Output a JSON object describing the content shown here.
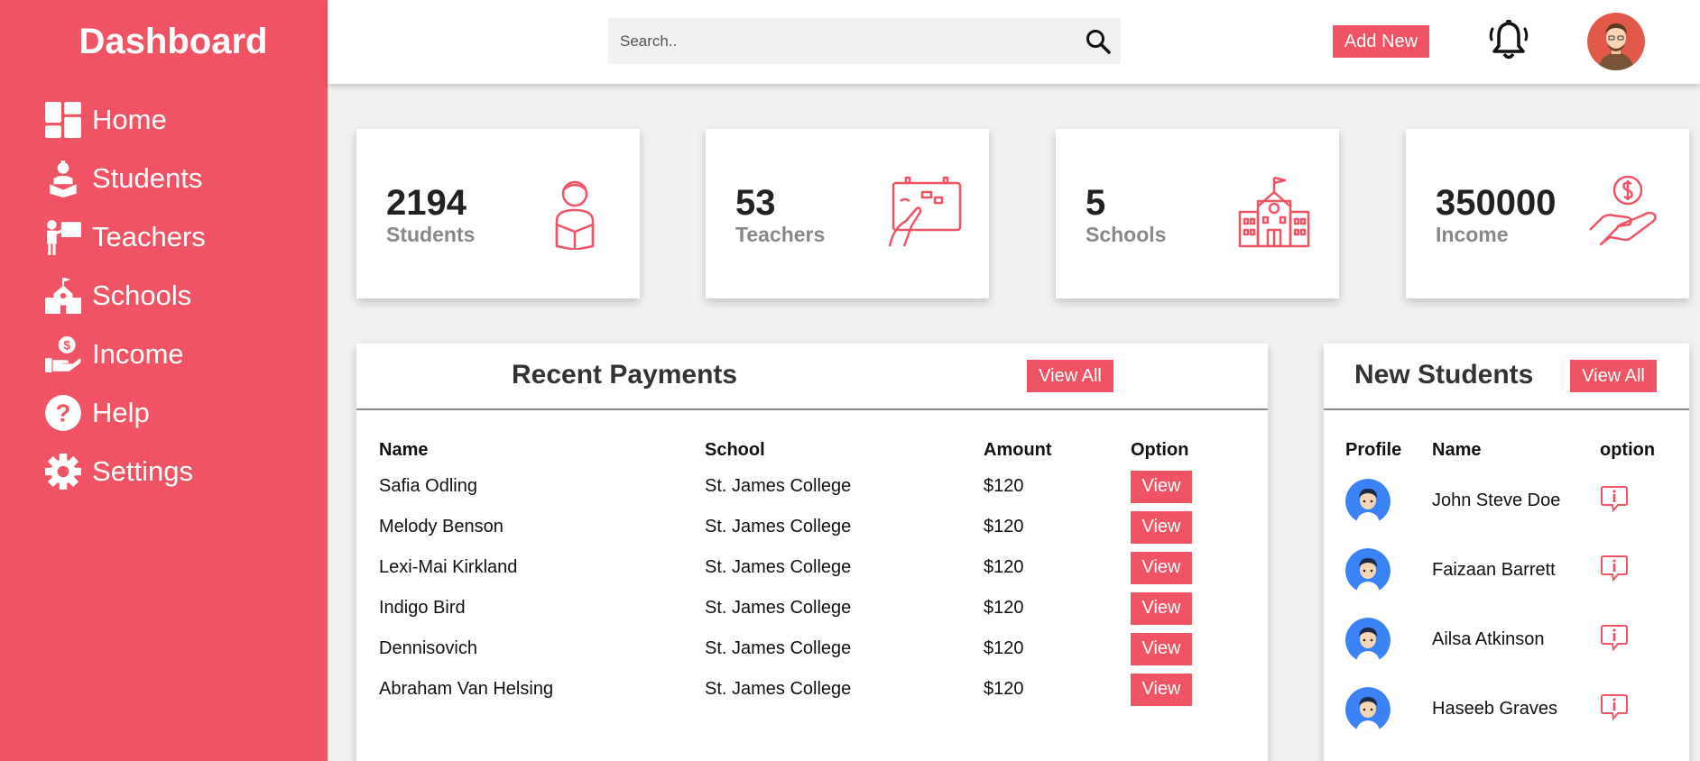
{
  "sidebar": {
    "title": "Dashboard",
    "items": [
      {
        "label": "Home",
        "icon": "grid-icon"
      },
      {
        "label": "Students",
        "icon": "student-icon"
      },
      {
        "label": "Teachers",
        "icon": "teacher-icon"
      },
      {
        "label": "Schools",
        "icon": "school-icon"
      },
      {
        "label": "Income",
        "icon": "income-icon"
      },
      {
        "label": "Help",
        "icon": "help-icon"
      },
      {
        "label": "Settings",
        "icon": "gear-icon"
      }
    ]
  },
  "topbar": {
    "search_placeholder": "Search..",
    "add_new_label": "Add New"
  },
  "cards": [
    {
      "value": "2194",
      "label": "Students",
      "icon": "student-reading-icon"
    },
    {
      "value": "53",
      "label": "Teachers",
      "icon": "teacher-board-icon"
    },
    {
      "value": "5",
      "label": "Schools",
      "icon": "school-building-icon"
    },
    {
      "value": "350000",
      "label": "Income",
      "icon": "money-hand-icon"
    }
  ],
  "payments": {
    "title": "Recent Payments",
    "view_all_label": "View All",
    "headers": {
      "name": "Name",
      "school": "School",
      "amount": "Amount",
      "option": "Option"
    },
    "rows": [
      {
        "name": "Safia Odling",
        "school": "St. James College",
        "amount": "$120",
        "action": "View"
      },
      {
        "name": "Melody Benson",
        "school": "St. James College",
        "amount": "$120",
        "action": "View"
      },
      {
        "name": "Lexi-Mai Kirkland",
        "school": "St. James College",
        "amount": "$120",
        "action": "View"
      },
      {
        "name": "Indigo Bird",
        "school": "St. James College",
        "amount": "$120",
        "action": "View"
      },
      {
        "name": "Dennisovich",
        "school": "St. James College",
        "amount": "$120",
        "action": "View"
      },
      {
        "name": "Abraham Van Helsing",
        "school": "St. James College",
        "amount": "$120",
        "action": "View"
      }
    ]
  },
  "new_students": {
    "title": "New Students",
    "view_all_label": "View All",
    "headers": {
      "profile": "Profile",
      "name": "Name",
      "option": "option"
    },
    "rows": [
      {
        "name": "John Steve Doe"
      },
      {
        "name": "Faizaan Barrett"
      },
      {
        "name": "Ailsa Atkinson"
      },
      {
        "name": "Haseeb Graves"
      }
    ]
  },
  "colors": {
    "accent": "#f05464",
    "background": "#f1f1f1",
    "avatar_blue": "#3b82f6"
  }
}
